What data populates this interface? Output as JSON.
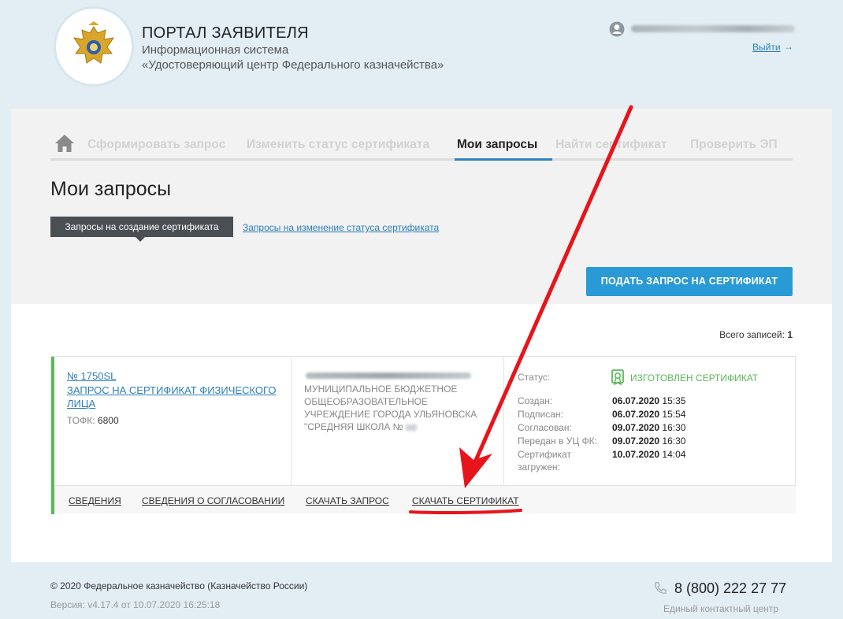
{
  "header": {
    "title": "ПОРТАЛ ЗАЯВИТЕЛЯ",
    "subtitle1": "Информационная система",
    "subtitle2": "«Удостоверяющий центр Федерального казначейства»",
    "logout": "Выйти",
    "logout_arrow": "→"
  },
  "nav": {
    "items": [
      "Сформировать запрос",
      "Изменить статус сертификата",
      "Мои запросы",
      "Найти сертификат",
      "Проверить ЭП"
    ],
    "active_index": 2
  },
  "page_title": "Мои запросы",
  "tabs": {
    "active": "Запросы на создание сертификата",
    "other": "Запросы на изменение статуса сертификата"
  },
  "submit_button": "ПОДАТЬ ЗАПРОС НА СЕРТИФИКАТ",
  "total": {
    "label": "Всего записей:",
    "value": "1"
  },
  "request": {
    "number": "№ 1750SL",
    "type": "ЗАПРОС НА СЕРТИФИКАТ ФИЗИЧЕСКОГО ЛИЦА",
    "tofk_label": "ТОФК:",
    "tofk_value": "6800",
    "org": "МУНИЦИПАЛЬНОЕ БЮДЖЕТНОЕ ОБЩЕОБРАЗОВАТЕЛЬНОЕ УЧРЕЖДЕНИЕ ГОРОДА УЛЬЯНОВСКА \"СРЕДНЯЯ ШКОЛА №",
    "status_label": "Статус:",
    "status_value": "ИЗГОТОВЛЕН СЕРТИФИКАТ",
    "dates": [
      {
        "label": "Создан:",
        "date": "06.07.2020",
        "time": "15:35"
      },
      {
        "label": "Подписан:",
        "date": "06.07.2020",
        "time": "15:54"
      },
      {
        "label": "Согласован:",
        "date": "09.07.2020",
        "time": "16:30"
      },
      {
        "label": "Передан в УЦ ФК:",
        "date": "09.07.2020",
        "time": "16:30"
      },
      {
        "label": "Сертификат загружен:",
        "date": "10.07.2020",
        "time": "14:04"
      }
    ],
    "actions": [
      "СВЕДЕНИЯ",
      "СВЕДЕНИЯ О СОГЛАСОВАНИИ",
      "СКАЧАТЬ ЗАПРОС",
      "СКАЧАТЬ СЕРТИФИКАТ"
    ]
  },
  "footer": {
    "copyright": "© 2020 Федеральное казначейство (Казначейство России)",
    "version": "Версия: v4.17.4 от 10.07.2020 16:25:18",
    "phone": "8 (800) 222 27 77",
    "contact": "Единый контактный центр"
  },
  "colors": {
    "accent": "#2a9ad6",
    "link": "#2a7fb8",
    "success": "#5cb85c",
    "annotation": "#e8141b"
  }
}
